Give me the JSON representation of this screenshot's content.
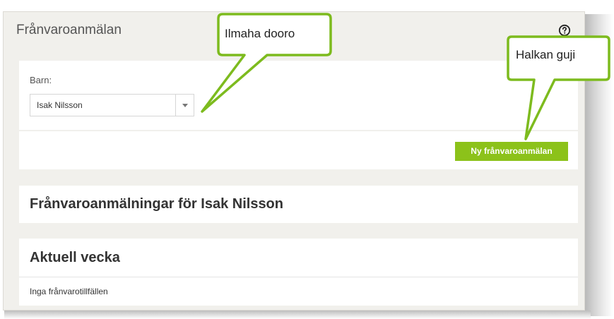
{
  "panel": {
    "title": "Frånvaroanmälan"
  },
  "icons": {
    "help": "help-circle-icon",
    "dropdown": "caret-down-icon"
  },
  "form": {
    "child_label": "Barn:",
    "child_selected": "Isak Nilsson"
  },
  "actions": {
    "new_report_label": "Ny frånvaroanmälan"
  },
  "reports": {
    "heading": "Frånvaroanmälningar för Isak Nilsson",
    "current_week": {
      "heading": "Aktuell vecka",
      "empty_text": "Inga frånvarotillfällen"
    }
  },
  "annotations": {
    "callout_1": "Ilmaha dooro",
    "callout_2": "Halkan guji",
    "border_color": "#7dbb1e"
  },
  "colors": {
    "accent": "#8cc21a",
    "panel_bg": "#f1f0ec",
    "text_dark": "#333333"
  }
}
